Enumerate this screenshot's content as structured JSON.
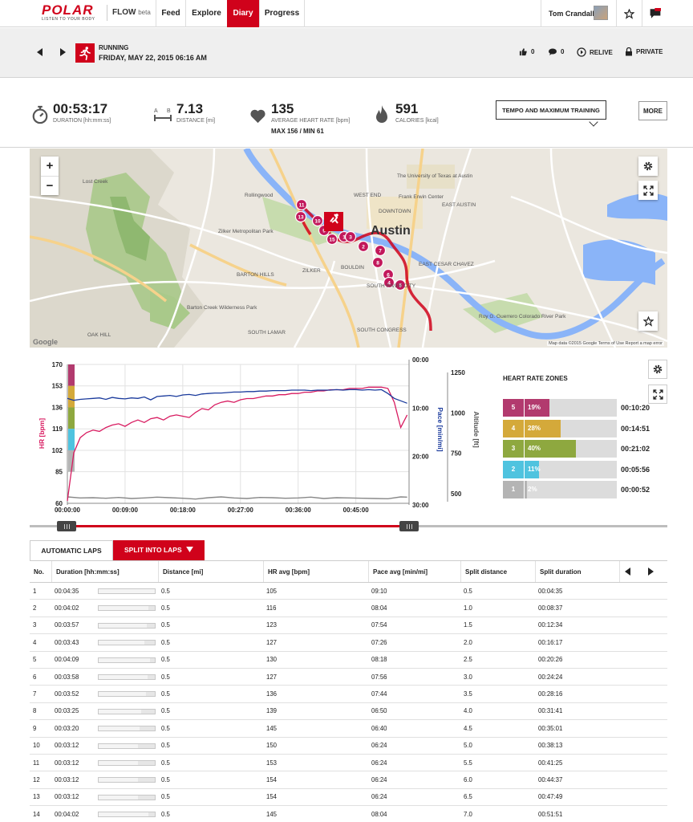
{
  "nav": {
    "brand": "POLAR",
    "tagline": "LISTEN TO YOUR BODY",
    "flow": "FLOW",
    "flow_tag": "beta",
    "tabs": [
      {
        "label": "Feed"
      },
      {
        "label": "Explore"
      },
      {
        "label": "Diary",
        "active": true
      },
      {
        "label": "Progress"
      }
    ],
    "user_name": "Tom Crandall",
    "icons": [
      "star-icon",
      "messages-icon"
    ]
  },
  "activity": {
    "sport": "RUNNING",
    "datetime": "FRIDAY, MAY 22, 2015 06:16 AM",
    "likes": "0",
    "comments": "0",
    "relive": "RELIVE",
    "privacy": "PRIVATE"
  },
  "stats": {
    "duration": {
      "value": "00:53:17",
      "label": "DURATION [hh:mm:ss]"
    },
    "distance": {
      "value": "7.13",
      "label": "DISTANCE [mi]",
      "icon_a": "A",
      "icon_b": "B"
    },
    "heart_rate": {
      "value": "135",
      "label": "AVERAGE HEART RATE [bpm]",
      "minmax": "MAX 156  /  MIN 61"
    },
    "calories": {
      "value": "591",
      "label": "CALORIES [kcal]"
    },
    "training_tag": "TEMPO AND MAXIMUM TRAINING",
    "more_button": "MORE"
  },
  "map": {
    "zoom_in": "+",
    "zoom_out": "−",
    "attribution": "Map data ©2015 Google   Terms of Use   Report a map error",
    "google": "Google",
    "labels": [
      {
        "text": "Austin",
        "big": true
      },
      {
        "text": "The University of Texas at Austin"
      },
      {
        "text": "Frank Erwin Center"
      },
      {
        "text": "Zilker Metropolitan Park"
      },
      {
        "text": "Rollingwood"
      },
      {
        "text": "Lost Creek"
      },
      {
        "text": "BARTON HILLS"
      },
      {
        "text": "Barton Creek Wilderness Park"
      },
      {
        "text": "SOUTH LAMAR"
      },
      {
        "text": "OAK HILL"
      },
      {
        "text": "EAST CESAR CHAVEZ"
      },
      {
        "text": "Roy G. Guerrero Colorado River Park"
      },
      {
        "text": "SOUTH RIVER CITY"
      },
      {
        "text": "DOWNTOWN"
      },
      {
        "text": "ZILKER"
      },
      {
        "text": "BOULDIN"
      },
      {
        "text": "WEST END"
      },
      {
        "text": "EAST AUSTIN"
      },
      {
        "text": "SOUTH CONGRESS"
      }
    ],
    "lap_markers": [
      "11",
      "13",
      "10",
      "9",
      "15",
      "1",
      "3",
      "2",
      "7",
      "6",
      "8",
      "4",
      "5"
    ]
  },
  "chart_data": {
    "type": "line",
    "x_ticks": [
      "00:00:00",
      "00:09:00",
      "00:18:00",
      "00:27:00",
      "00:36:00",
      "00:45:00"
    ],
    "hr_axis": {
      "label": "HR [bpm]",
      "ticks": [
        "170",
        "153",
        "136",
        "119",
        "102",
        "85",
        "60"
      ]
    },
    "pace_axis": {
      "label": "Pace [min/mi]",
      "ticks": [
        "00:00",
        "10:00",
        "20:00",
        "30:00"
      ]
    },
    "altitude_axis": {
      "label": "Altitude [ft]",
      "ticks": [
        "1250",
        "1000",
        "750",
        "500"
      ]
    },
    "series": [
      {
        "name": "HR",
        "color": "#d81b60",
        "x_min": [
          0,
          1,
          2,
          3,
          4,
          5,
          6,
          7,
          8,
          9,
          10,
          11,
          12,
          13,
          14,
          15,
          16,
          17,
          18,
          19,
          20,
          21,
          22,
          23,
          24,
          25,
          26,
          27,
          28,
          29,
          30,
          31,
          32,
          33,
          34,
          35,
          36,
          37,
          38,
          39,
          40,
          41,
          42,
          43,
          44,
          45,
          46,
          47,
          48,
          49,
          50,
          51,
          52,
          53
        ],
        "values": [
          62,
          100,
          112,
          116,
          118,
          117,
          120,
          122,
          123,
          121,
          124,
          126,
          124,
          127,
          128,
          126,
          129,
          130,
          129,
          128,
          132,
          135,
          134,
          138,
          140,
          141,
          140,
          142,
          143,
          143,
          144,
          145,
          145,
          146,
          146,
          147,
          147,
          148,
          148,
          149,
          149,
          150,
          150,
          150,
          151,
          151,
          151,
          152,
          152,
          152,
          151,
          140,
          120,
          130
        ]
      },
      {
        "name": "Pace",
        "color": "#1a3a9c",
        "x_min": [
          0,
          1,
          2,
          3,
          4,
          5,
          6,
          7,
          8,
          9,
          10,
          11,
          12,
          13,
          14,
          15,
          16,
          17,
          18,
          19,
          20,
          21,
          22,
          23,
          24,
          25,
          26,
          27,
          28,
          29,
          30,
          31,
          32,
          33,
          34,
          35,
          36,
          37,
          38,
          39,
          40,
          41,
          42,
          43,
          44,
          45,
          46,
          47,
          48,
          49,
          50,
          51,
          52,
          53
        ],
        "values": [
          8.0,
          8.4,
          8.2,
          8.1,
          8.0,
          7.9,
          8.2,
          7.8,
          8.0,
          8.1,
          7.9,
          8.0,
          7.7,
          8.3,
          7.6,
          7.5,
          7.4,
          7.6,
          7.3,
          7.2,
          7.4,
          7.1,
          7.0,
          6.9,
          6.9,
          6.8,
          6.7,
          6.7,
          6.6,
          6.6,
          6.5,
          6.5,
          6.4,
          6.4,
          6.4,
          6.3,
          6.3,
          6.3,
          6.4,
          6.3,
          6.3,
          6.3,
          6.2,
          6.3,
          6.2,
          6.2,
          6.3,
          6.2,
          6.3,
          6.2,
          7.0,
          8.0,
          8.5,
          9.0
        ]
      },
      {
        "name": "Altitude",
        "color": "#888888",
        "x_min": [
          0,
          2,
          4,
          6,
          8,
          10,
          12,
          14,
          16,
          18,
          20,
          22,
          24,
          26,
          28,
          30,
          32,
          34,
          36,
          38,
          40,
          42,
          44,
          46,
          48,
          50,
          52,
          53
        ],
        "values": [
          560,
          540,
          545,
          535,
          550,
          530,
          540,
          555,
          545,
          535,
          520,
          545,
          560,
          540,
          530,
          550,
          545,
          535,
          540,
          555,
          530,
          545,
          540,
          535,
          530,
          525,
          560,
          555
        ]
      }
    ]
  },
  "hr_zones": {
    "title": "HEART RATE ZONES",
    "zones": [
      {
        "zone": "5",
        "pct": "19%",
        "fraction": 0.19,
        "time": "00:10:20",
        "color": "#b23a6e"
      },
      {
        "zone": "4",
        "pct": "28%",
        "fraction": 0.28,
        "time": "00:14:51",
        "color": "#d4a93a"
      },
      {
        "zone": "3",
        "pct": "40%",
        "fraction": 0.4,
        "time": "00:21:02",
        "color": "#8ea83f"
      },
      {
        "zone": "2",
        "pct": "11%",
        "fraction": 0.11,
        "time": "00:05:56",
        "color": "#4fc3df"
      },
      {
        "zone": "1",
        "pct": "2%",
        "fraction": 0.02,
        "time": "00:00:52",
        "color": "#b4b4b4"
      }
    ]
  },
  "laps": {
    "tab_auto": "AUTOMATIC LAPS",
    "tab_split": "SPLIT INTO LAPS",
    "headers": [
      "No.",
      "Duration [hh:mm:ss]",
      "Distance [mi]",
      "HR avg [bpm]",
      "Pace avg [min/mi]",
      "Split distance",
      "Split duration"
    ],
    "rows": [
      {
        "no": "1",
        "duration": "00:04:35",
        "bar": 1.0,
        "distance": "0.5",
        "hr": "105",
        "pace": "09:10",
        "split_dist": "0.5",
        "split_dur": "00:04:35"
      },
      {
        "no": "2",
        "duration": "00:04:02",
        "bar": 0.88,
        "distance": "0.5",
        "hr": "116",
        "pace": "08:04",
        "split_dist": "1.0",
        "split_dur": "00:08:37"
      },
      {
        "no": "3",
        "duration": "00:03:57",
        "bar": 0.86,
        "distance": "0.5",
        "hr": "123",
        "pace": "07:54",
        "split_dist": "1.5",
        "split_dur": "00:12:34"
      },
      {
        "no": "4",
        "duration": "00:03:43",
        "bar": 0.81,
        "distance": "0.5",
        "hr": "127",
        "pace": "07:26",
        "split_dist": "2.0",
        "split_dur": "00:16:17"
      },
      {
        "no": "5",
        "duration": "00:04:09",
        "bar": 0.91,
        "distance": "0.5",
        "hr": "130",
        "pace": "08:18",
        "split_dist": "2.5",
        "split_dur": "00:20:26"
      },
      {
        "no": "6",
        "duration": "00:03:58",
        "bar": 0.87,
        "distance": "0.5",
        "hr": "127",
        "pace": "07:56",
        "split_dist": "3.0",
        "split_dur": "00:24:24"
      },
      {
        "no": "7",
        "duration": "00:03:52",
        "bar": 0.84,
        "distance": "0.5",
        "hr": "136",
        "pace": "07:44",
        "split_dist": "3.5",
        "split_dur": "00:28:16"
      },
      {
        "no": "8",
        "duration": "00:03:25",
        "bar": 0.75,
        "distance": "0.5",
        "hr": "139",
        "pace": "06:50",
        "split_dist": "4.0",
        "split_dur": "00:31:41"
      },
      {
        "no": "9",
        "duration": "00:03:20",
        "bar": 0.73,
        "distance": "0.5",
        "hr": "145",
        "pace": "06:40",
        "split_dist": "4.5",
        "split_dur": "00:35:01"
      },
      {
        "no": "10",
        "duration": "00:03:12",
        "bar": 0.7,
        "distance": "0.5",
        "hr": "150",
        "pace": "06:24",
        "split_dist": "5.0",
        "split_dur": "00:38:13"
      },
      {
        "no": "11",
        "duration": "00:03:12",
        "bar": 0.7,
        "distance": "0.5",
        "hr": "153",
        "pace": "06:24",
        "split_dist": "5.5",
        "split_dur": "00:41:25"
      },
      {
        "no": "12",
        "duration": "00:03:12",
        "bar": 0.7,
        "distance": "0.5",
        "hr": "154",
        "pace": "06:24",
        "split_dist": "6.0",
        "split_dur": "00:44:37"
      },
      {
        "no": "13",
        "duration": "00:03:12",
        "bar": 0.7,
        "distance": "0.5",
        "hr": "154",
        "pace": "06:24",
        "split_dist": "6.5",
        "split_dur": "00:47:49"
      },
      {
        "no": "14",
        "duration": "00:04:02",
        "bar": 0.88,
        "distance": "0.5",
        "hr": "145",
        "pace": "08:04",
        "split_dist": "7.0",
        "split_dur": "00:51:51"
      }
    ]
  }
}
